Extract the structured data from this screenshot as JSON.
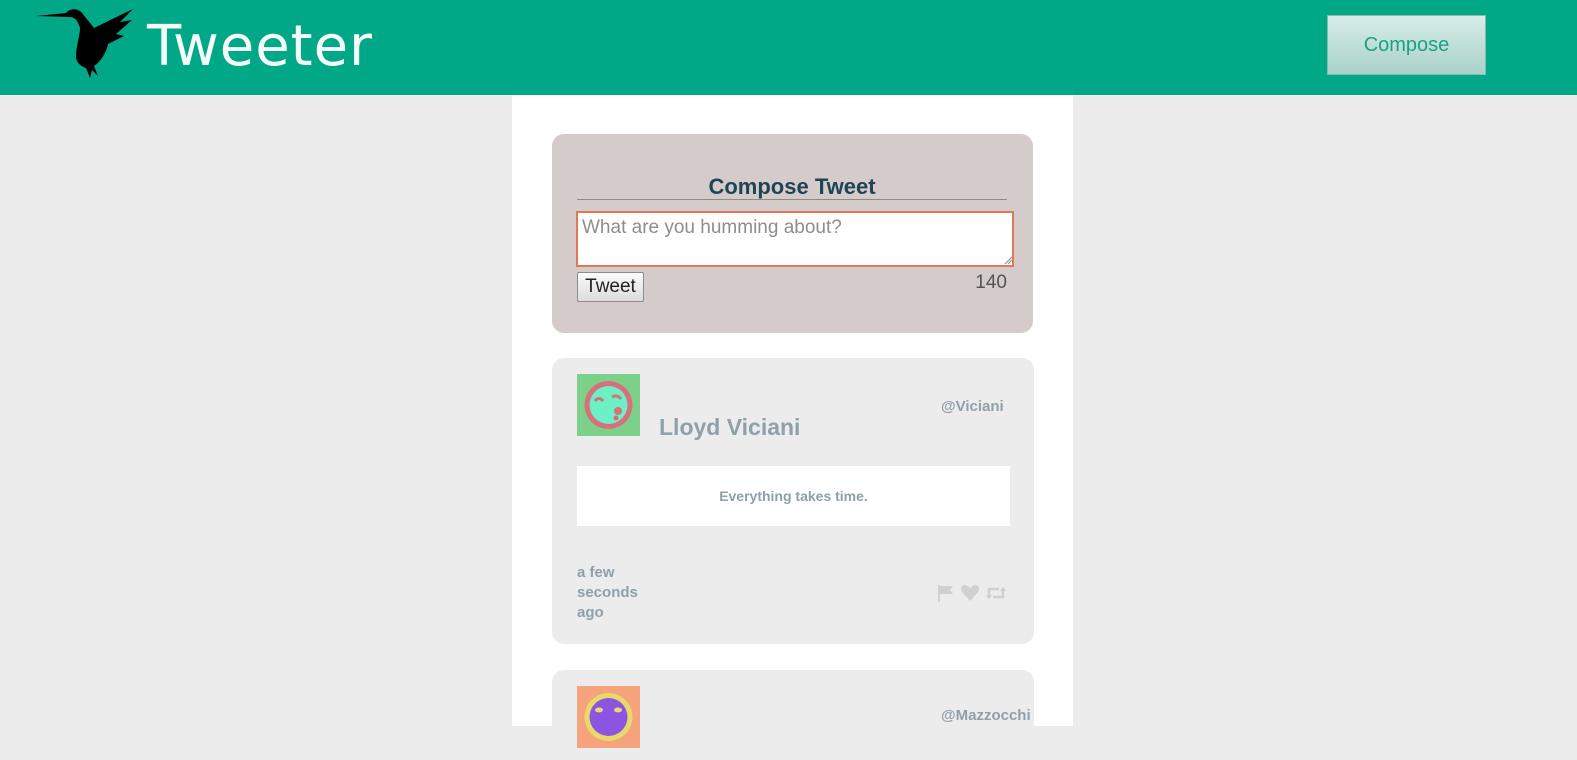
{
  "header": {
    "brand": "Tweeter",
    "compose_label": "Compose",
    "logo_icon": "hummingbird-icon",
    "background": "#00a887"
  },
  "composer": {
    "title": "Compose Tweet",
    "placeholder": "What are you humming about?",
    "submit_label": "Tweet",
    "char_counter": "140",
    "input_border": "#e07a56"
  },
  "tweets": [
    {
      "author": "Lloyd Viciani",
      "handle": "@Viciani",
      "content": "Everything takes time.",
      "timestamp": "a few seconds ago",
      "avatar_icon": "kissing-face-avatar-icon",
      "avatar_bg": "#7dd08a",
      "actions": [
        "flag-icon",
        "heart-icon",
        "retweet-icon"
      ]
    },
    {
      "handle": "@Mazzocchi",
      "avatar_icon": "surprised-face-avatar-icon",
      "avatar_bg": "#f5a37c"
    }
  ]
}
